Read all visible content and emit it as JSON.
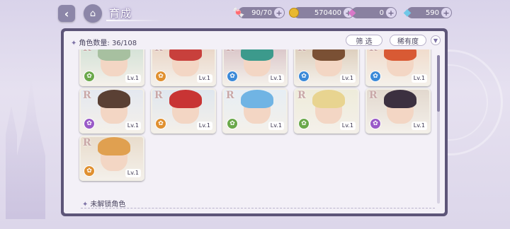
{
  "header": {
    "back_icon": "back-arrow-icon",
    "home_icon": "home-icon",
    "title": "育成"
  },
  "resources": {
    "stamina": {
      "icon": "candy-icon",
      "value": "90/70",
      "color": "#e0506a"
    },
    "coins": {
      "icon": "coin-icon",
      "value": "570400",
      "color": "#e8b830"
    },
    "gem_pink": {
      "icon": "pink-gem-icon",
      "value": "0",
      "color": "#d878c8"
    },
    "gem_blue": {
      "icon": "blue-gem-icon",
      "value": "590",
      "color": "#70c8e8"
    },
    "plus": "+"
  },
  "panel": {
    "count_label": "角色数量: 36/108",
    "filter_button": "筛 选",
    "rarity_button": "稀有度",
    "sort_icon": "sort-toggle-icon",
    "locked_section": "未解锁角色"
  },
  "cards": [
    {
      "rank": "R",
      "level": "Lv.1",
      "element": "green",
      "hair": "#a7c0a0",
      "bg": "#cfe0d4"
    },
    {
      "rank": "R",
      "level": "Lv.1",
      "element": "orange",
      "hair": "#c8403c",
      "bg": "#e8d2c2"
    },
    {
      "rank": "R",
      "level": "Lv.1",
      "element": "blue",
      "hair": "#3c9a8c",
      "bg": "#d6c0c4"
    },
    {
      "rank": "R",
      "level": "Lv.1",
      "element": "blue",
      "hair": "#7a5034",
      "bg": "#d9c9b5"
    },
    {
      "rank": "R",
      "level": "Lv.1",
      "element": "blue",
      "hair": "#d85a34",
      "bg": "#f0d8c6"
    },
    {
      "rank": "R",
      "level": "Lv.1",
      "element": "purple",
      "hair": "#5a4034",
      "bg": "#e4e8f0"
    },
    {
      "rank": "R",
      "level": "Lv.1",
      "element": "orange",
      "hair": "#c83434",
      "bg": "#dfe6ee"
    },
    {
      "rank": "R",
      "level": "Lv.1",
      "element": "green",
      "hair": "#70b4e4",
      "bg": "#e6eef4"
    },
    {
      "rank": "R",
      "level": "Lv.1",
      "element": "green",
      "hair": "#e8d490",
      "bg": "#eeecda"
    },
    {
      "rank": "R",
      "level": "Lv.1",
      "element": "purple",
      "hair": "#3c3040",
      "bg": "#e2d8ce"
    },
    {
      "rank": "R",
      "level": "Lv.1",
      "element": "orange",
      "hair": "#e0a050",
      "bg": "#e8dccc"
    }
  ],
  "element_colors": {
    "green": "#6aa84a",
    "orange": "#e09030",
    "blue": "#3c8ad8",
    "purple": "#9a5ac8"
  }
}
